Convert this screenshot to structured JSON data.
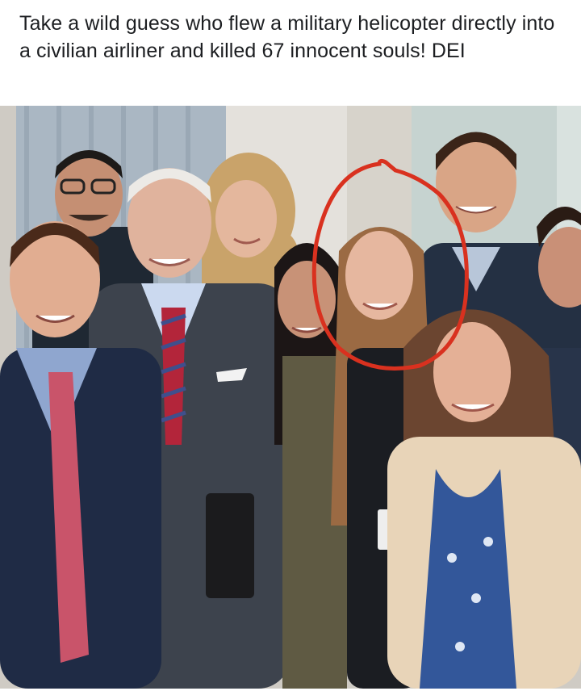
{
  "post": {
    "caption": "Take a wild guess who flew a military helicopter directly into a civilian airliner and killed 67 innocent souls! DEI"
  },
  "photo": {
    "annotation_color": "#d9311f",
    "background_color": "#c9c6bf",
    "people_count": 10,
    "badge_text": ""
  }
}
